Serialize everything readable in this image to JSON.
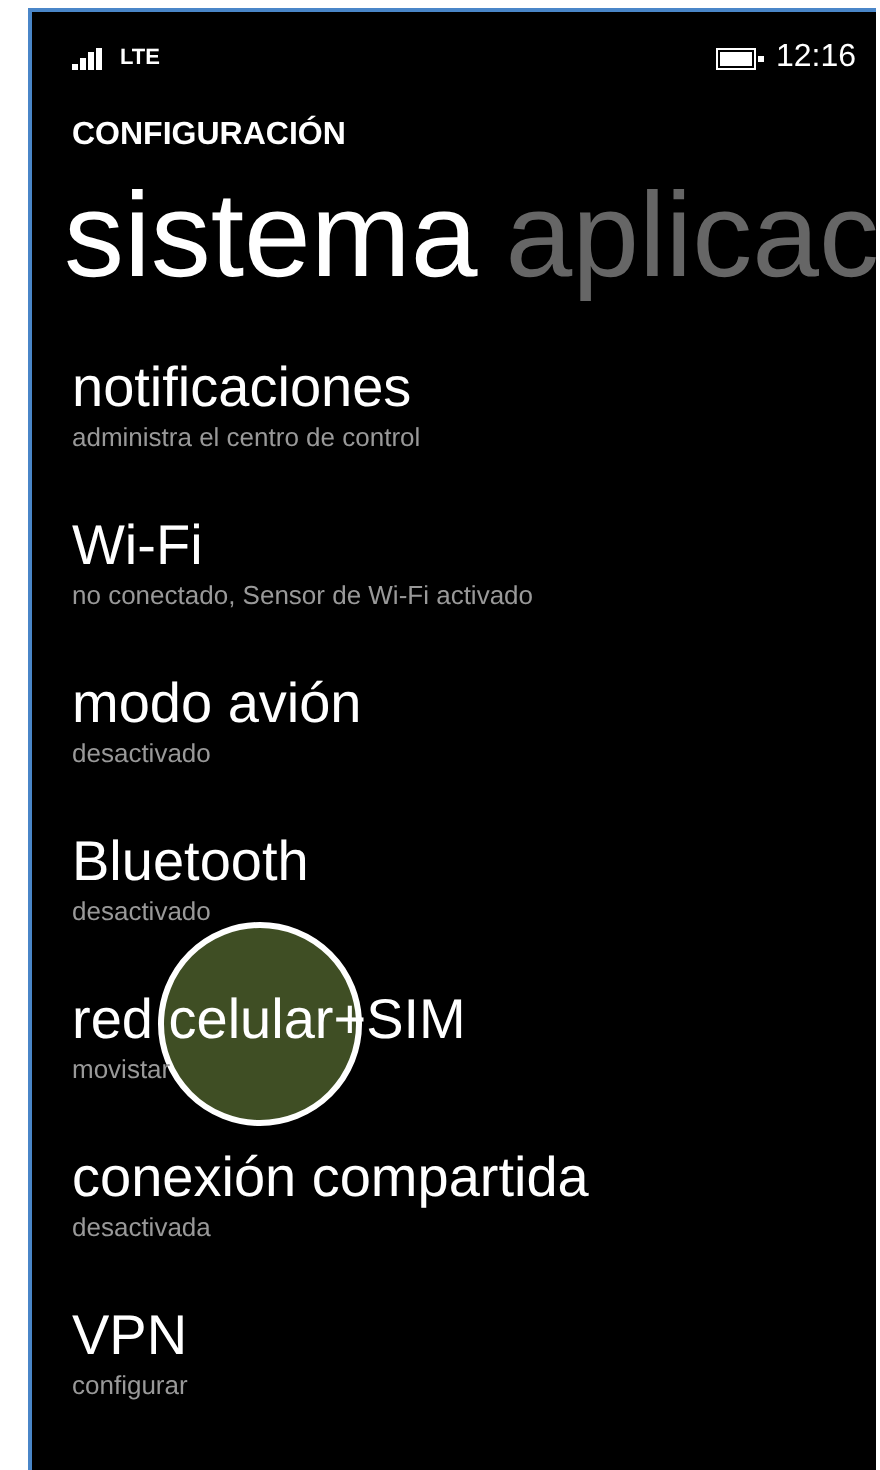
{
  "status_bar": {
    "network": "LTE",
    "time": "12:16"
  },
  "header": {
    "app_title": "CONFIGURACIÓN"
  },
  "pivots": [
    {
      "label": "sistema",
      "selected": true
    },
    {
      "label": "aplicac",
      "selected": false
    }
  ],
  "items": [
    {
      "title": "notificaciones",
      "subtitle": "administra el centro de control",
      "touched": false
    },
    {
      "title": "Wi-Fi",
      "subtitle": "no conectado, Sensor de Wi-Fi activado",
      "touched": false
    },
    {
      "title": "modo avión",
      "subtitle": "desactivado",
      "touched": false
    },
    {
      "title": "Bluetooth",
      "subtitle": "desactivado",
      "touched": false
    },
    {
      "title": "red celular+SIM",
      "subtitle": "movistar",
      "touched": true
    },
    {
      "title": "conexión compartida",
      "subtitle": "desactivada",
      "touched": false
    },
    {
      "title": "VPN",
      "subtitle": "configurar",
      "touched": false
    }
  ]
}
